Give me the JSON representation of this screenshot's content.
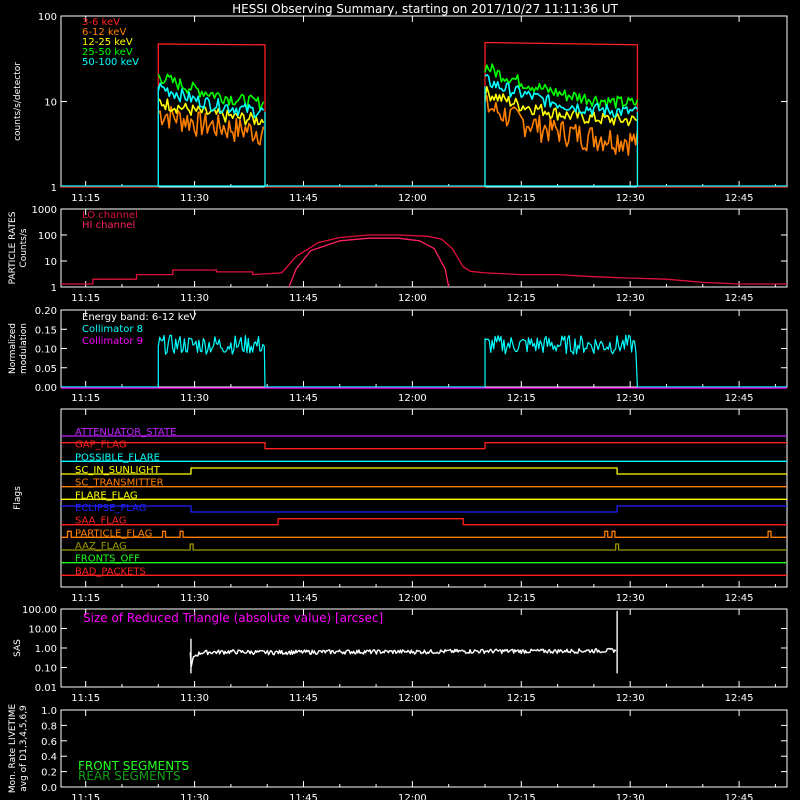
{
  "page_title": "HESSI Observing Summary, starting on 2017/10/27 11:11:36 UT",
  "time_ticks": [
    "11:15",
    "11:30",
    "11:45",
    "12:00",
    "12:15",
    "12:30",
    "12:45"
  ],
  "time_tick_minutes": [
    15,
    30,
    45,
    60,
    75,
    90,
    105
  ],
  "time_range_minutes": [
    11.6,
    111.6
  ],
  "colors": {
    "background": "#000000",
    "axes": "#ffffff",
    "ch_3_6": "#ff2020",
    "ch_6_12": "#ff8000",
    "ch_12_25": "#ffff00",
    "ch_25_50": "#00ff00",
    "ch_50_100": "#00ffff",
    "particle": "#e0103c",
    "magenta": "#ff00ff"
  },
  "chart_data": [
    {
      "id": "count_rates",
      "type": "line",
      "ylabel": "counts/s/detector",
      "yscale": "log",
      "ylim": [
        1,
        100
      ],
      "ytick_labels": [
        "1",
        "10",
        "100"
      ],
      "legend_position": "top-left",
      "series": [
        {
          "name": "3-6 keV",
          "color": "#ff2020",
          "x": [
            11.6,
            25.0,
            25.0,
            39.7,
            39.7,
            70.0,
            70.0,
            91.0,
            91.0,
            111.6
          ],
          "y": [
            1,
            1,
            47,
            46,
            1,
            1,
            49,
            46,
            1,
            1
          ]
        },
        {
          "name": "6-12 keV",
          "color": "#ff8000",
          "x": [
            25.0,
            27.0,
            30.0,
            33.0,
            36.0,
            39.7,
            70.0,
            72.0,
            75.0,
            78.0,
            81.0,
            84.0,
            87.0,
            91.0
          ],
          "y": [
            7.5,
            6.8,
            5.8,
            5.2,
            4.8,
            4.5,
            9.0,
            7.5,
            6.0,
            5.0,
            4.5,
            4.0,
            3.8,
            3.5
          ]
        },
        {
          "name": "12-25 keV",
          "color": "#ffff00",
          "x": [
            25.0,
            27.0,
            30.0,
            33.0,
            36.0,
            39.7,
            70.0,
            72.0,
            75.0,
            78.0,
            81.0,
            84.0,
            87.0,
            91.0
          ],
          "y": [
            10,
            9,
            7.8,
            7.0,
            6.5,
            6.0,
            13,
            11,
            9,
            8,
            7,
            6.5,
            6.2,
            6.0
          ]
        },
        {
          "name": "25-50 keV",
          "color": "#00ff00",
          "x": [
            25.0,
            27.0,
            30.0,
            33.0,
            36.0,
            39.7,
            70.0,
            72.0,
            75.0,
            78.0,
            81.0,
            84.0,
            87.0,
            91.0
          ],
          "y": [
            20,
            17,
            14,
            12,
            10.5,
            9.5,
            26,
            21,
            17,
            14,
            12,
            11,
            10,
            9.5
          ]
        },
        {
          "name": "50-100 keV",
          "color": "#00ffff",
          "x": [
            25.0,
            27.0,
            30.0,
            33.0,
            36.0,
            39.7,
            70.0,
            72.0,
            75.0,
            78.0,
            81.0,
            84.0,
            87.0,
            91.0
          ],
          "y": [
            15,
            13,
            10.5,
            9.2,
            8.3,
            7.6,
            18,
            15,
            12.5,
            10.5,
            9.2,
            8.4,
            7.9,
            7.5
          ]
        }
      ]
    },
    {
      "id": "particle_rates",
      "type": "line",
      "ylabel": "PARTICLE RATES\nCounts/s",
      "yscale": "log",
      "ylim": [
        1,
        1000
      ],
      "ytick_labels": [
        "1",
        "10",
        "100",
        "1000"
      ],
      "legend_position": "top-left",
      "series": [
        {
          "name": "LO channel",
          "color": "#e0103c",
          "x": [
            11.6,
            16.0,
            16.0,
            22.0,
            22.0,
            27.0,
            27.0,
            33.0,
            33.0,
            38.0,
            38.0,
            42.0,
            44.0,
            47.0,
            50.0,
            54.0,
            58.0,
            62.0,
            64.0,
            65.5,
            67.0,
            68.0,
            70.0,
            75.0,
            80.0,
            85.0,
            90.0,
            95.0,
            100.0,
            105.0,
            111.6
          ],
          "y": [
            1.3,
            1.3,
            2.0,
            2.0,
            3.0,
            3.0,
            4.5,
            4.5,
            3.8,
            3.8,
            3.0,
            3.5,
            15,
            50,
            80,
            100,
            100,
            90,
            70,
            30,
            6.0,
            4.0,
            3.5,
            3.0,
            3.0,
            2.5,
            2.2,
            2.0,
            1.5,
            1.3,
            1.3
          ]
        },
        {
          "name": "HI channel",
          "color": "#ff2060",
          "x": [
            43.0,
            44.0,
            46.0,
            50.0,
            54.0,
            58.0,
            61.0,
            63.0,
            64.5,
            65.0
          ],
          "y": [
            1,
            5,
            25,
            60,
            75,
            75,
            60,
            30,
            5,
            1
          ]
        }
      ]
    },
    {
      "id": "modulation",
      "type": "line",
      "ylabel": "Normalized\nmodulation",
      "ylim": [
        0,
        0.2
      ],
      "ytick_labels": [
        "0.00",
        "0.05",
        "0.10",
        "0.15",
        "0.20"
      ],
      "legend_position": "top-left",
      "legend_title": "Energy band: 6-12 keV",
      "series": [
        {
          "name": "Collimator 8",
          "color": "#00ffff",
          "x": [
            11.6,
            25.0,
            25.0,
            39.7,
            39.7,
            70.0,
            70.0,
            91.0,
            91.0,
            111.6
          ],
          "y": [
            0,
            0,
            0.11,
            0.11,
            0,
            0,
            0.11,
            0.11,
            0,
            0
          ]
        },
        {
          "name": "Collimator 9",
          "color": "#ff00ff",
          "x": [
            11.6,
            111.6
          ],
          "y": [
            0,
            0
          ]
        }
      ]
    },
    {
      "id": "flags",
      "type": "line",
      "ylabel": "Flags",
      "series": [
        {
          "name": "ATTENUATOR_STATE",
          "color": "#c020ff",
          "x": [
            11.6,
            111.6
          ],
          "y": [
            0,
            0
          ]
        },
        {
          "name": "GAP_FLAG",
          "color": "#ff2020",
          "x": [
            11.6,
            39.7,
            39.7,
            70.0,
            70.0,
            111.6
          ],
          "y": [
            1,
            1,
            0,
            0,
            1,
            1
          ]
        },
        {
          "name": "POSSIBLE_FLARE",
          "color": "#00ffff",
          "x": [
            11.6,
            111.6
          ],
          "y": [
            0,
            0
          ]
        },
        {
          "name": "SC_IN_SUNLIGHT",
          "color": "#ffff00",
          "x": [
            11.6,
            29.5,
            29.5,
            88.2,
            88.2,
            111.6
          ],
          "y": [
            0,
            0,
            1,
            1,
            0,
            0
          ]
        },
        {
          "name": "SC_TRANSMITTER",
          "color": "#ff8000",
          "x": [
            11.6,
            111.6
          ],
          "y": [
            0,
            0
          ]
        },
        {
          "name": "FLARE_FLAG",
          "color": "#ffff00",
          "x": [
            11.6,
            111.6
          ],
          "y": [
            0,
            0
          ]
        },
        {
          "name": "ECLIPSE_FLAG",
          "color": "#2020ff",
          "x": [
            11.6,
            29.5,
            29.5,
            88.2,
            88.2,
            111.6
          ],
          "y": [
            1,
            1,
            0,
            0,
            1,
            1
          ]
        },
        {
          "name": "SAA_FLAG",
          "color": "#ff2020",
          "x": [
            11.6,
            41.5,
            41.5,
            67.0,
            67.0,
            111.6
          ],
          "y": [
            0,
            0,
            1,
            1,
            0,
            0
          ]
        },
        {
          "name": "PARTICLE_FLAG",
          "color": "#ff8000",
          "x": [
            11.6,
            12.5,
            12.5,
            13.0,
            13.0,
            25.6,
            25.6,
            26.0,
            26.0,
            28.0,
            28.0,
            28.4,
            28.4,
            86.5,
            86.5,
            86.9,
            86.9,
            87.5,
            87.5,
            87.9,
            87.9,
            109.0,
            109.0,
            109.4,
            109.4,
            111.6
          ],
          "y": [
            0,
            0,
            1,
            1,
            0,
            0,
            1,
            1,
            0,
            0,
            1,
            1,
            0,
            0,
            1,
            1,
            0,
            0,
            1,
            1,
            0,
            0,
            1,
            1,
            0,
            0
          ]
        },
        {
          "name": "AAZ_FLAG",
          "color": "#9a9a00",
          "x": [
            11.6,
            29.4,
            29.4,
            29.8,
            29.8,
            88.0,
            88.0,
            88.4,
            88.4,
            111.6
          ],
          "y": [
            0,
            0,
            1,
            1,
            0,
            0,
            1,
            1,
            0,
            0
          ]
        },
        {
          "name": "FRONTS_OFF",
          "color": "#20ff20",
          "x": [
            11.6,
            111.6
          ],
          "y": [
            0,
            0
          ]
        },
        {
          "name": "BAD_PACKETS",
          "color": "#ff2020",
          "x": [
            11.6,
            111.6
          ],
          "y": [
            0,
            0
          ]
        }
      ]
    },
    {
      "id": "sas",
      "type": "line",
      "title": "Size of Reduced Triangle (absolute value) [arcsec]",
      "ylabel": "SAS",
      "yscale": "log",
      "ylim": [
        0.01,
        100
      ],
      "ytick_labels": [
        "0.01",
        "0.10",
        "1.00",
        "10.00",
        "100.00"
      ],
      "series": [
        {
          "name": "",
          "color": "#ffffff",
          "x": [
            29.4,
            29.5,
            30.0,
            31.0,
            35.0,
            40.0,
            50.0,
            60.0,
            70.0,
            80.0,
            87.0,
            88.0,
            88.2
          ],
          "y": [
            0.5,
            0.07,
            0.4,
            0.6,
            0.65,
            0.6,
            0.65,
            0.65,
            0.7,
            0.7,
            0.75,
            0.8,
            0.05
          ]
        }
      ]
    },
    {
      "id": "livetime",
      "type": "line",
      "ylabel": "Mon. Rate LIVETIME\navg of D1,3,4,5,6,9",
      "ylim": [
        0,
        1.0
      ],
      "ytick_labels": [
        "0.0",
        "0.2",
        "0.4",
        "0.6",
        "0.8",
        "1.0"
      ],
      "legend_position": "bottom-left",
      "series": [
        {
          "name": "FRONT SEGMENTS",
          "color": "#20ff20",
          "x": [],
          "y": []
        },
        {
          "name": "REAR SEGMENTS",
          "color": "#10a010",
          "x": [],
          "y": []
        }
      ]
    }
  ]
}
